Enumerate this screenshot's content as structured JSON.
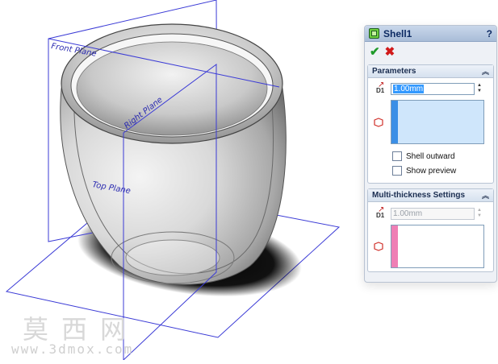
{
  "panel": {
    "title": "Shell1",
    "help": "?",
    "ok_symbol": "✔",
    "cancel_symbol": "✖"
  },
  "parameters": {
    "header": "Parameters",
    "collapse_symbol": "︽",
    "thickness_icon_label": "D1",
    "thickness_value": "1.00mm",
    "shell_outward_label": "Shell outward",
    "show_preview_label": "Show preview"
  },
  "multi_thickness": {
    "header": "Multi-thickness Settings",
    "collapse_symbol": "︽",
    "thickness_icon_label": "D1",
    "thickness_value": "1.00mm"
  },
  "viewport": {
    "front_plane": "Front Plane",
    "right_plane": "Right Plane",
    "top_plane": "Top Plane"
  },
  "watermark": {
    "chinese": "莫西网",
    "url": "www.3dmox.com"
  },
  "colors": {
    "plane_line": "#3b3bd6",
    "accent_ok": "#1f9a2a",
    "accent_cancel": "#d11a1a",
    "selection_blue": "#3b8fe6",
    "selection_pink": "#ef7fb5"
  }
}
